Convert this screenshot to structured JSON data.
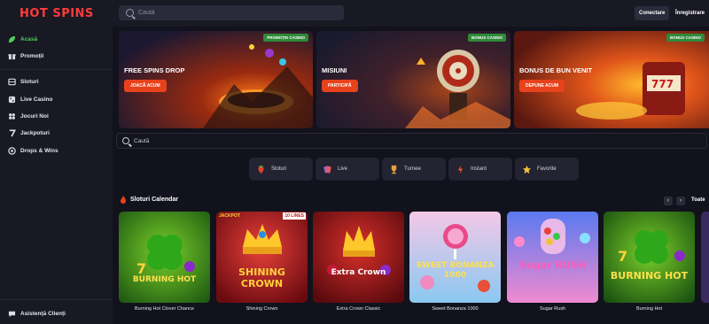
{
  "header": {
    "logo": "HOT SPINS",
    "search_placeholder": "Caută",
    "login_label": "Conectare",
    "register_label": "Înregistrare"
  },
  "sidebar": {
    "items": [
      {
        "label": "Acasă",
        "icon": "leaf-icon"
      },
      {
        "label": "Promoții",
        "icon": "gift-icon"
      },
      {
        "label": "Sloturi",
        "icon": "slot-icon"
      },
      {
        "label": "Live Casino",
        "icon": "dice-icon"
      },
      {
        "label": "Jocuri Noi",
        "icon": "grid-icon"
      },
      {
        "label": "Jackpoturi",
        "icon": "seven-icon"
      },
      {
        "label": "Drops & Wins",
        "icon": "chip-icon"
      }
    ],
    "support_label": "Asistență Clienți"
  },
  "banners": [
    {
      "tag": "PROMOȚIE CASINO",
      "title": "FREE SPINS DROP",
      "button": "JOACĂ ACUM"
    },
    {
      "tag": "BONUS CASINO",
      "title": "MISIUNI",
      "button": "PARTICIPĂ"
    },
    {
      "tag": "BONUS CASINO",
      "title": "BONUS DE BUN VENIT",
      "button": "DEPUNE ACUM"
    }
  ],
  "search_main": {
    "placeholder": "Caută"
  },
  "categories": [
    {
      "label": "Sloturi"
    },
    {
      "label": "Live"
    },
    {
      "label": "Turnee"
    },
    {
      "label": "Instant"
    },
    {
      "label": "Favorite"
    }
  ],
  "section": {
    "title": "Sloturi Calendar",
    "see_all": "Toate",
    "prev": "‹",
    "next": "›"
  },
  "games": [
    {
      "name": "Burning Hot Clover Chance",
      "art": "BURNING HOT"
    },
    {
      "name": "Shining Crown",
      "art": "SHINING CROWN",
      "badge": "10 LINES",
      "jackpot": "JACKPOT"
    },
    {
      "name": "Extra Crown Classic",
      "art": "Extra Crown"
    },
    {
      "name": "Sweet Bonanza 1000",
      "art": "SWEET BONANZA 1000"
    },
    {
      "name": "Sugar Rush",
      "art": "Sugar RUSH"
    },
    {
      "name": "Burning Hot",
      "art": "BURNING HOT"
    }
  ],
  "colors": {
    "accent_green": "#4bd15c",
    "button_red": "#e8421c",
    "tag_green": "#2f8a3a",
    "background": "#12121d",
    "panel": "#191924"
  }
}
